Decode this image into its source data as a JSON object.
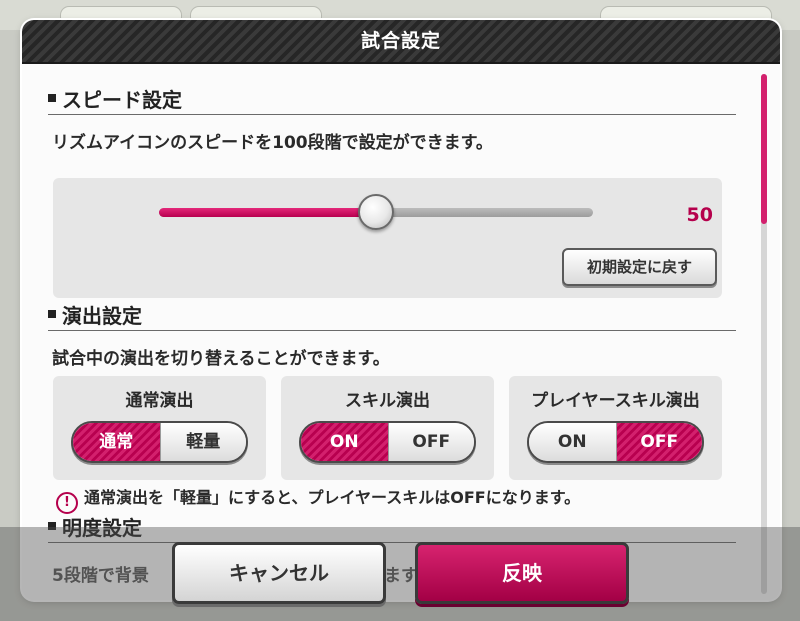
{
  "dialog": {
    "title": "試合設定"
  },
  "speed": {
    "heading": "スピード設定",
    "description": "リズムアイコンのスピードを100段階で設定ができます。",
    "value": "50",
    "value_fraction": 0.5,
    "reset_label": "初期設定に戻す"
  },
  "effects": {
    "heading": "演出設定",
    "description": "試合中の演出を切り替えることができます。",
    "cards": [
      {
        "title": "通常演出",
        "left": "通常",
        "right": "軽量",
        "selected": "left"
      },
      {
        "title": "スキル演出",
        "left": "ON",
        "right": "OFF",
        "selected": "left"
      },
      {
        "title": "プレイヤースキル演出",
        "left": "ON",
        "right": "OFF",
        "selected": "right"
      }
    ],
    "warning_icon": "!",
    "warning": "通常演出を「軽量」にすると、プレイヤースキルはOFFになります。"
  },
  "brightness": {
    "heading": "明度設定",
    "description_part1": "5段階で背景",
    "description_part2": "ます"
  },
  "buttons": {
    "cancel": "キャンセル",
    "apply": "反映"
  },
  "colors": {
    "accent": "#b5004c",
    "title_bar": "#2e2e2e"
  },
  "icons": {
    "warning": "exclamation-circle-icon"
  }
}
